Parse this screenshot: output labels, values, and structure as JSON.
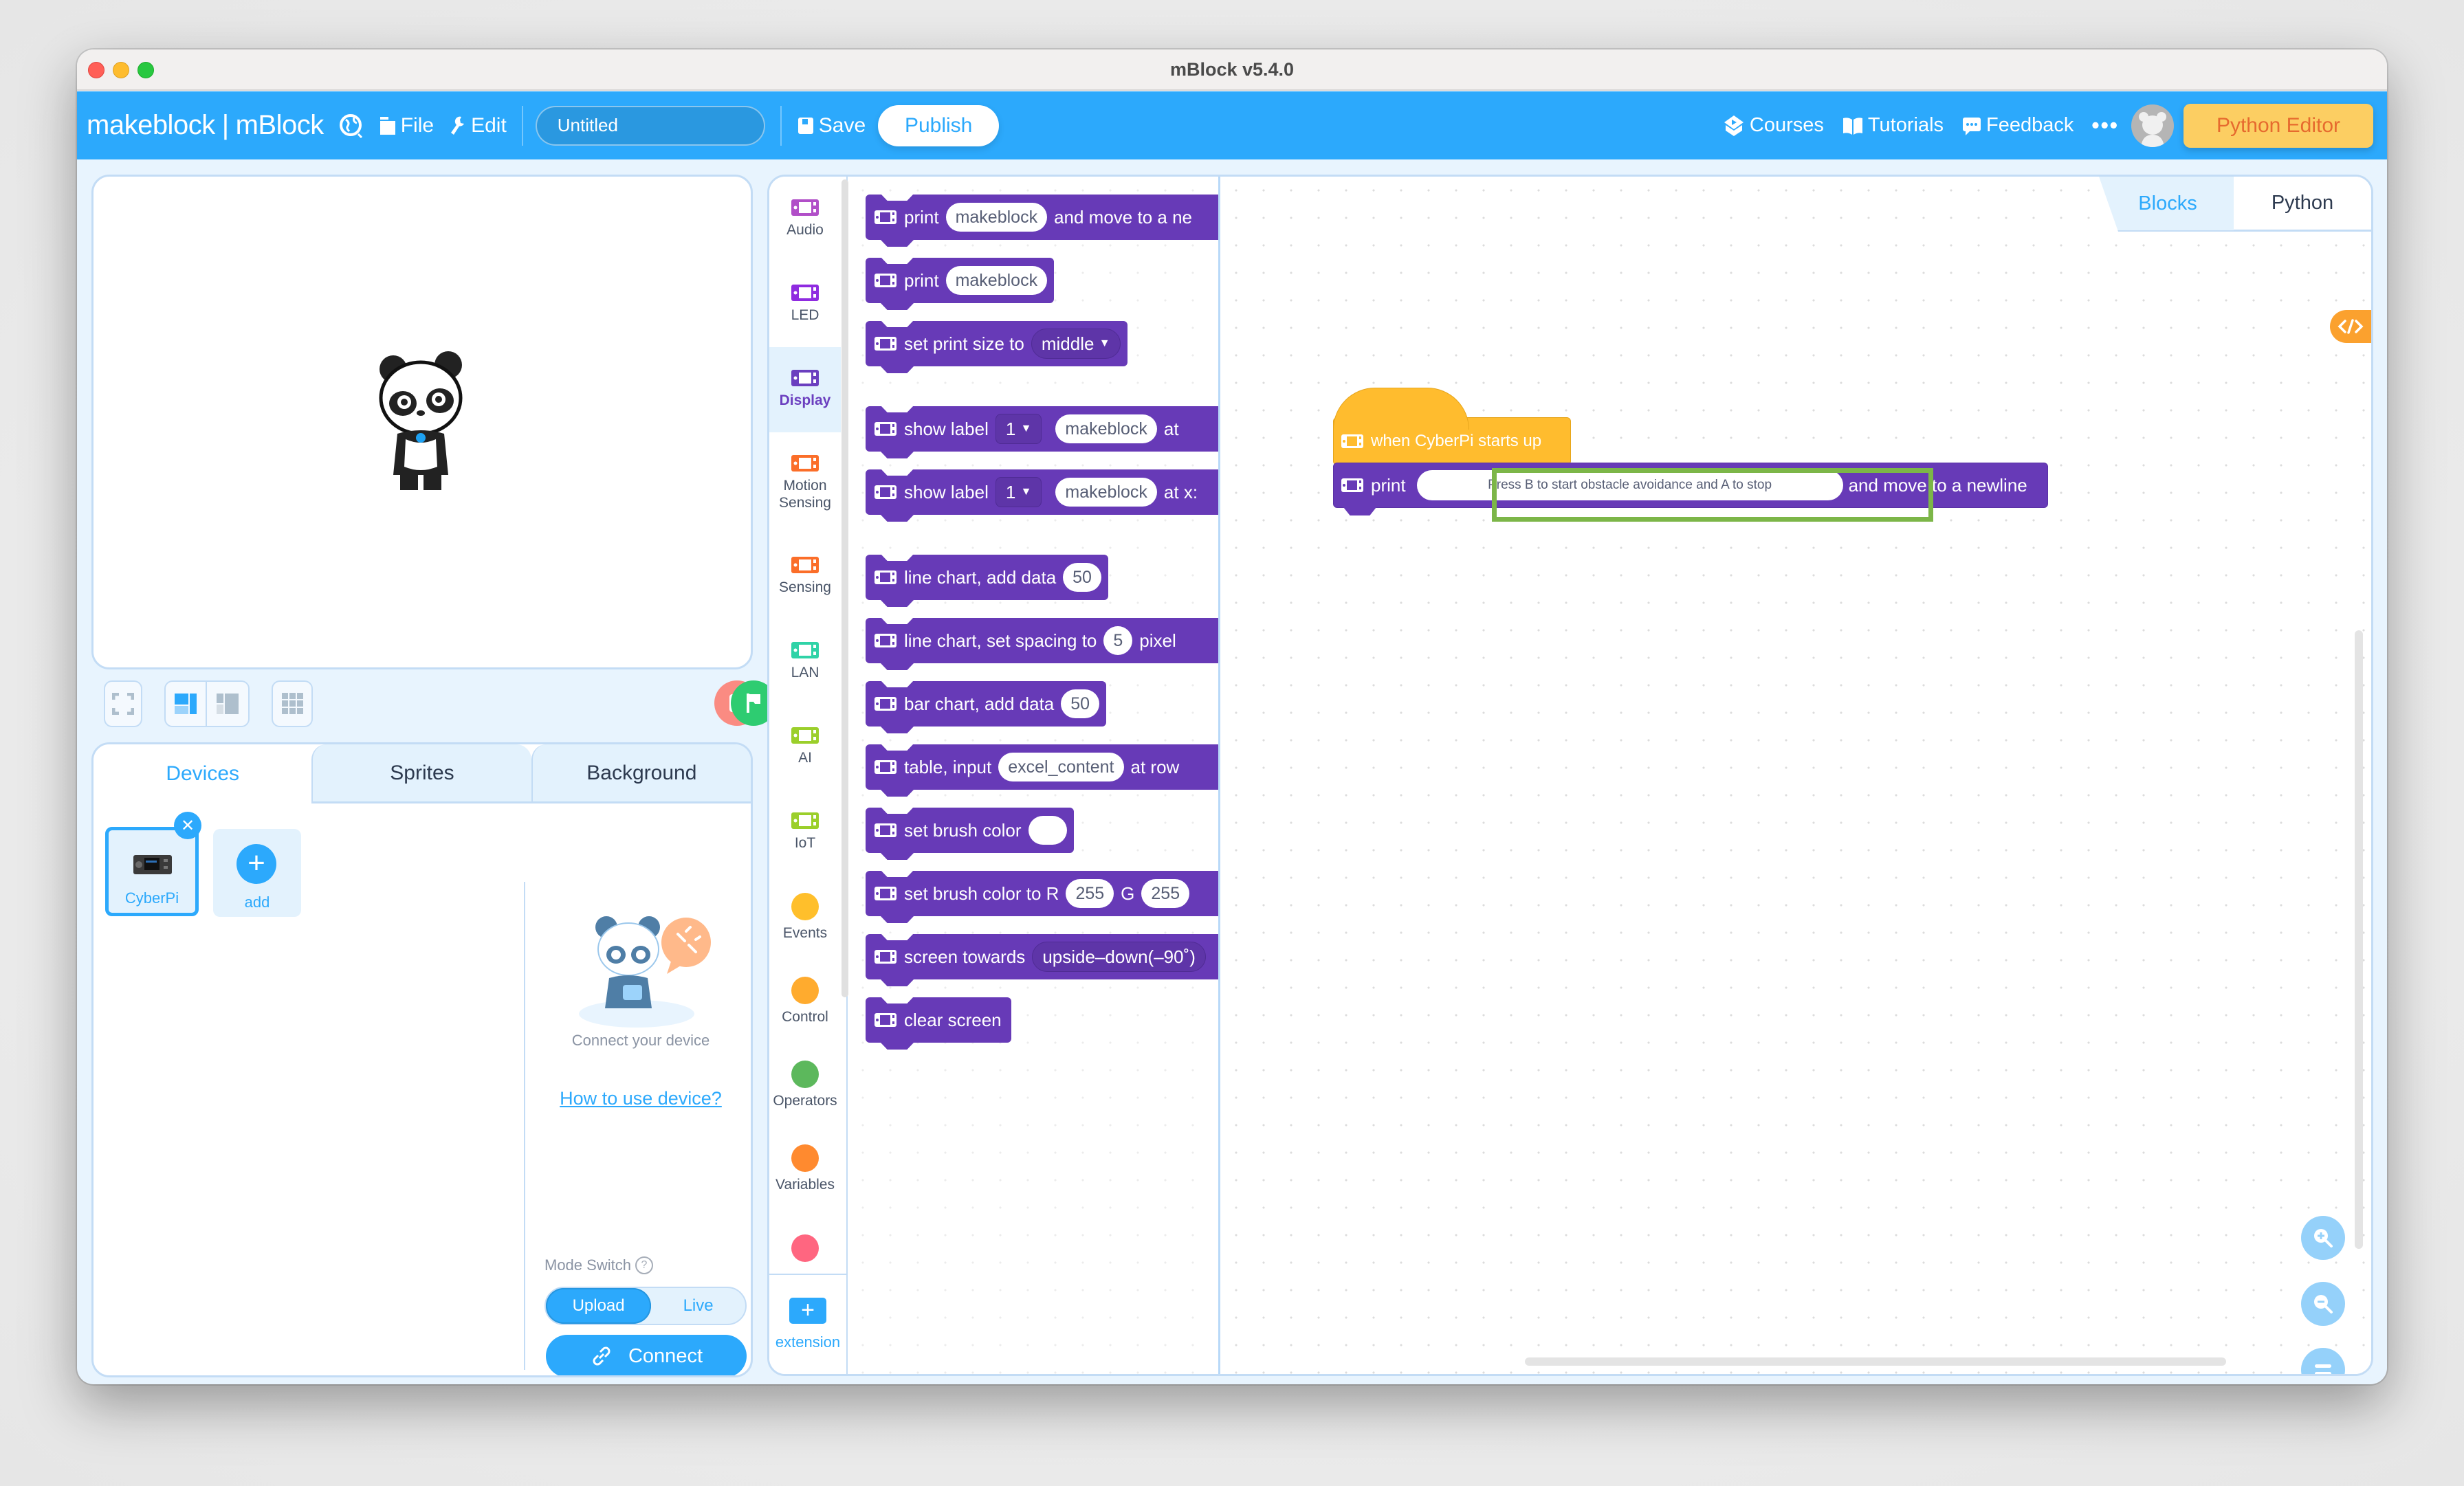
{
  "window": {
    "title": "mBlock v5.4.0"
  },
  "topbar": {
    "brand": "makeblock",
    "product": "mBlock",
    "menu": {
      "file": "File",
      "edit": "Edit"
    },
    "project_title": {
      "value": "Untitled",
      "placeholder": "Untitled"
    },
    "save": "Save",
    "publish": "Publish",
    "courses": "Courses",
    "tutorials": "Tutorials",
    "feedback": "Feedback",
    "more": "•••",
    "python_editor": "Python Editor"
  },
  "devices_panel": {
    "tabs": [
      {
        "label": "Devices",
        "active": true
      },
      {
        "label": "Sprites",
        "active": false
      },
      {
        "label": "Background",
        "active": false
      }
    ],
    "device": {
      "name": "CyberPi",
      "selected": true
    },
    "add_label": "add",
    "connect_text": "Connect your device",
    "howto_link": "How to use device?",
    "mode_switch_label": "Mode Switch",
    "mode_options": [
      {
        "label": "Upload",
        "active": true
      },
      {
        "label": "Live",
        "active": false
      }
    ],
    "connect_button": "Connect"
  },
  "categories": [
    {
      "label": "Audio",
      "color": "#b14fc8",
      "icon": "device-icon"
    },
    {
      "label": "LED",
      "color": "#8f2be0",
      "icon": "device-icon"
    },
    {
      "label": "Display",
      "color": "#6b3fbf",
      "icon": "device-icon",
      "active": true
    },
    {
      "label": "Motion Sensing",
      "color": "#fb6e29",
      "icon": "device-icon"
    },
    {
      "label": "Sensing",
      "color": "#fb6e29",
      "icon": "device-icon"
    },
    {
      "label": "LAN",
      "color": "#2fd3a7",
      "icon": "device-icon"
    },
    {
      "label": "AI",
      "color": "#9bcf2b",
      "icon": "device-icon"
    },
    {
      "label": "IoT",
      "color": "#9bcf2b",
      "icon": "device-icon"
    },
    {
      "label": "Events",
      "color": "#ffbf2b",
      "icon": "dot"
    },
    {
      "label": "Control",
      "color": "#ffab2e",
      "icon": "dot"
    },
    {
      "label": "Operators",
      "color": "#5cb85c",
      "icon": "dot"
    },
    {
      "label": "Variables",
      "color": "#ff8a2f",
      "icon": "dot"
    },
    {
      "label": "",
      "color": "#ff6680",
      "icon": "dot"
    }
  ],
  "extension_label": "extension",
  "palette": {
    "b0": {
      "text": "print",
      "arg": "makeblock",
      "tail": "and move to a ne"
    },
    "b1": {
      "text": "print",
      "arg": "makeblock"
    },
    "b2": {
      "text": "set print size to",
      "dropdown": "middle"
    },
    "b3": {
      "text": "show label",
      "dropdown": "1",
      "arg": "makeblock",
      "tail": "at"
    },
    "b4": {
      "text": "show label",
      "dropdown": "1",
      "arg": "makeblock",
      "tail": "at x:"
    },
    "b5": {
      "text": "line chart, add data",
      "arg": "50"
    },
    "b6": {
      "text": "line chart, set spacing to",
      "arg": "5",
      "tail": "pixel"
    },
    "b7": {
      "text": "bar chart, add data",
      "arg": "50"
    },
    "b8": {
      "text": "table, input",
      "arg": "excel_content",
      "tail": "at row"
    },
    "b9": {
      "text": "set brush color",
      "arg": ""
    },
    "b10": {
      "text": "set brush color to R",
      "arg": "255",
      "mid": "G",
      "arg2": "255"
    },
    "b11": {
      "text": "screen towards",
      "dropdown": "upside–down(–90˚)"
    },
    "b12": {
      "text": "clear screen"
    }
  },
  "workspace": {
    "view_tabs": {
      "blocks": "Blocks",
      "python": "Python",
      "active": "Blocks"
    },
    "hat_block": "when CyberPi starts up",
    "print_block": {
      "prefix": "print",
      "message": "Press B to start obstacle avoidance and A to stop",
      "suffix": "and move to a newline"
    }
  },
  "colors": {
    "accent": "#2ca9fc",
    "display_block": "#673ab7",
    "event_block": "#ffbc2e",
    "highlight": "#7cb648",
    "python_editor_bg": "#fcce62",
    "python_editor_text": "#e66a2e"
  }
}
